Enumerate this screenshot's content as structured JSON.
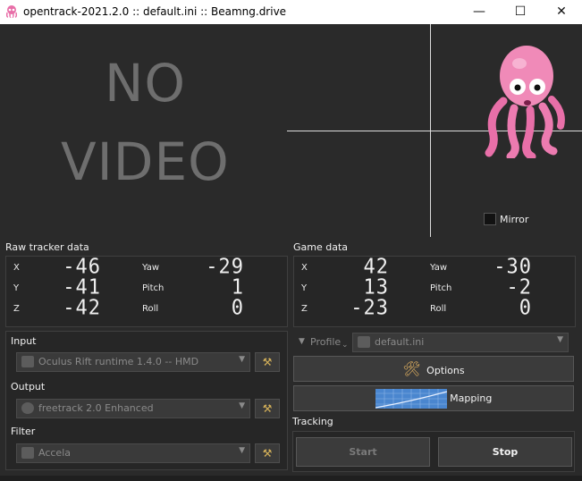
{
  "window": {
    "title": "opentrack-2021.2.0 :: default.ini :: Beamng.drive",
    "minimize": "—",
    "maximize": "☐",
    "close": "✕"
  },
  "video": {
    "line1": "NO",
    "line2": "VIDEO",
    "mirror_label": "Mirror"
  },
  "raw_tracker": {
    "title": "Raw tracker data",
    "rows": [
      {
        "axis": "X",
        "value": "-46",
        "rot": "Yaw",
        "rot_value": "-29"
      },
      {
        "axis": "Y",
        "value": "-41",
        "rot": "Pitch",
        "rot_value": "1"
      },
      {
        "axis": "Z",
        "value": "-42",
        "rot": "Roll",
        "rot_value": "0"
      }
    ]
  },
  "game_data": {
    "title": "Game data",
    "rows": [
      {
        "axis": "X",
        "value": "42",
        "rot": "Yaw",
        "rot_value": "-30"
      },
      {
        "axis": "Y",
        "value": "13",
        "rot": "Pitch",
        "rot_value": "-2"
      },
      {
        "axis": "Z",
        "value": "-23",
        "rot": "Roll",
        "rot_value": "0"
      }
    ]
  },
  "input": {
    "label": "Input",
    "value": "Oculus Rift runtime 1.4.0 -- HMD"
  },
  "output": {
    "label": "Output",
    "value": "freetrack 2.0 Enhanced"
  },
  "filter": {
    "label": "Filter",
    "value": "Accela"
  },
  "profile": {
    "label": "Profile",
    "value": "default.ini"
  },
  "buttons": {
    "options": "Options",
    "mapping": "Mapping",
    "start": "Start",
    "stop": "Stop"
  },
  "tracking": {
    "label": "Tracking"
  },
  "colors": {
    "background": "#2a2a2a",
    "box": "#262626",
    "accent_pink": "#e86fa8"
  }
}
